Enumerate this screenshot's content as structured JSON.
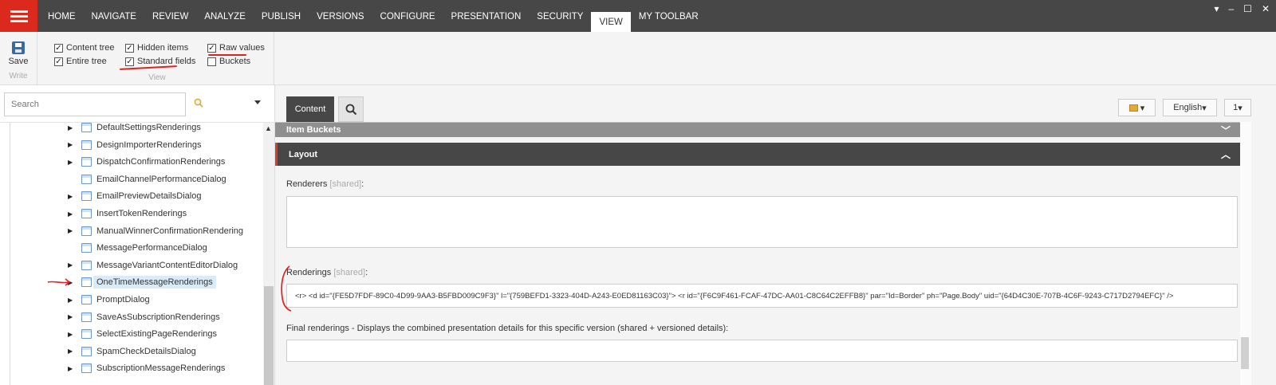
{
  "nav": {
    "tabs": [
      "HOME",
      "NAVIGATE",
      "REVIEW",
      "ANALYZE",
      "PUBLISH",
      "VERSIONS",
      "CONFIGURE",
      "PRESENTATION",
      "SECURITY",
      "VIEW",
      "MY TOOLBAR"
    ],
    "active_tab": "VIEW",
    "window_controls": [
      "▾",
      "–",
      "☐",
      "✕"
    ]
  },
  "ribbon": {
    "save_label": "Save",
    "write_group_label": "Write",
    "view_group_label": "View",
    "checkboxes": [
      {
        "label": "Content tree",
        "checked": true
      },
      {
        "label": "Hidden items",
        "checked": true
      },
      {
        "label": "Raw values",
        "checked": true
      },
      {
        "label": "Entire tree",
        "checked": true
      },
      {
        "label": "Standard fields",
        "checked": true
      },
      {
        "label": "Buckets",
        "checked": false
      }
    ]
  },
  "search": {
    "placeholder": "Search"
  },
  "tree": {
    "items": [
      {
        "label": "DefaultSettingsRenderings",
        "expandable": true
      },
      {
        "label": "DesignImporterRenderings",
        "expandable": true
      },
      {
        "label": "DispatchConfirmationRenderings",
        "expandable": true
      },
      {
        "label": "EmailChannelPerformanceDialog",
        "expandable": false
      },
      {
        "label": "EmailPreviewDetailsDialog",
        "expandable": true
      },
      {
        "label": "InsertTokenRenderings",
        "expandable": true
      },
      {
        "label": "ManualWinnerConfirmationRendering",
        "expandable": true
      },
      {
        "label": "MessagePerformanceDialog",
        "expandable": false
      },
      {
        "label": "MessageVariantContentEditorDialog",
        "expandable": true
      },
      {
        "label": "OneTimeMessageRenderings",
        "expandable": true,
        "selected": true
      },
      {
        "label": "PromptDialog",
        "expandable": true
      },
      {
        "label": "SaveAsSubscriptionRenderings",
        "expandable": true
      },
      {
        "label": "SelectExistingPageRenderings",
        "expandable": true
      },
      {
        "label": "SpamCheckDetailsDialog",
        "expandable": true
      },
      {
        "label": "SubscriptionMessageRenderings",
        "expandable": true
      }
    ]
  },
  "editor": {
    "content_tab": "Content",
    "language": "English",
    "version": "1",
    "sections": {
      "item_buckets": "Item Buckets",
      "layout": "Layout"
    },
    "fields": {
      "renderers_label": "Renderers",
      "renderings_label": "Renderings",
      "shared_tag": "[shared]",
      "final_renderings_label": "Final renderings - Displays the combined presentation details for this specific version (shared + versioned details):",
      "renderings_value": "<r>  <d id=\"{FE5D7FDF-89C0-4D99-9AA3-B5FBD009C9F3}\" l=\"{759BEFD1-3323-404D-A243-E0ED81163C03}\">    <r id=\"{F6C9F461-FCAF-47DC-AA01-C8C64C2EFFB8}\" par=\"Id=Border\" ph=\"Page.Body\" uid=\"{64D4C30E-707B-4C6F-9243-C717D2794EFC}\" />"
    }
  },
  "colors": {
    "nav_bg": "#474747",
    "menu_red": "#dc291e",
    "annotation_red": "#d22222"
  }
}
